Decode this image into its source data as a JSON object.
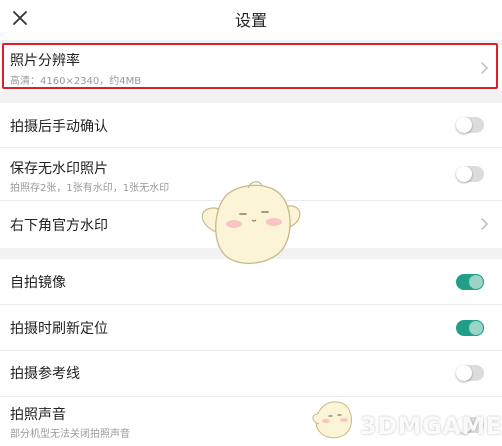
{
  "header": {
    "title": "设置",
    "close_icon": "close-icon"
  },
  "groups": [
    {
      "rows": [
        {
          "label": "照片分辨率",
          "subtitle": "高清：4160×2340，约4MB",
          "control": "chevron"
        }
      ]
    },
    {
      "rows": [
        {
          "label": "拍摄后手动确认",
          "control": "toggle",
          "on": false
        },
        {
          "label": "保存无水印照片",
          "subtitle": "拍照存2张，1张有水印，1张无水印",
          "control": "toggle",
          "on": false
        },
        {
          "label": "右下角官方水印",
          "control": "chevron"
        }
      ]
    },
    {
      "rows": [
        {
          "label": "自拍镜像",
          "control": "toggle",
          "on": true
        },
        {
          "label": "拍摄时刷新定位",
          "control": "toggle",
          "on": true
        },
        {
          "label": "拍摄参考线",
          "control": "toggle",
          "on": false
        },
        {
          "label": "拍照声音",
          "subtitle": "部分机型无法关闭拍照声音",
          "control": "toggle",
          "on": false
        }
      ]
    }
  ],
  "watermark": {
    "text": "3DMGAME"
  },
  "colors": {
    "accent": "#1f9f88",
    "highlight": "#e21f26",
    "background": "#f2f2f2"
  }
}
